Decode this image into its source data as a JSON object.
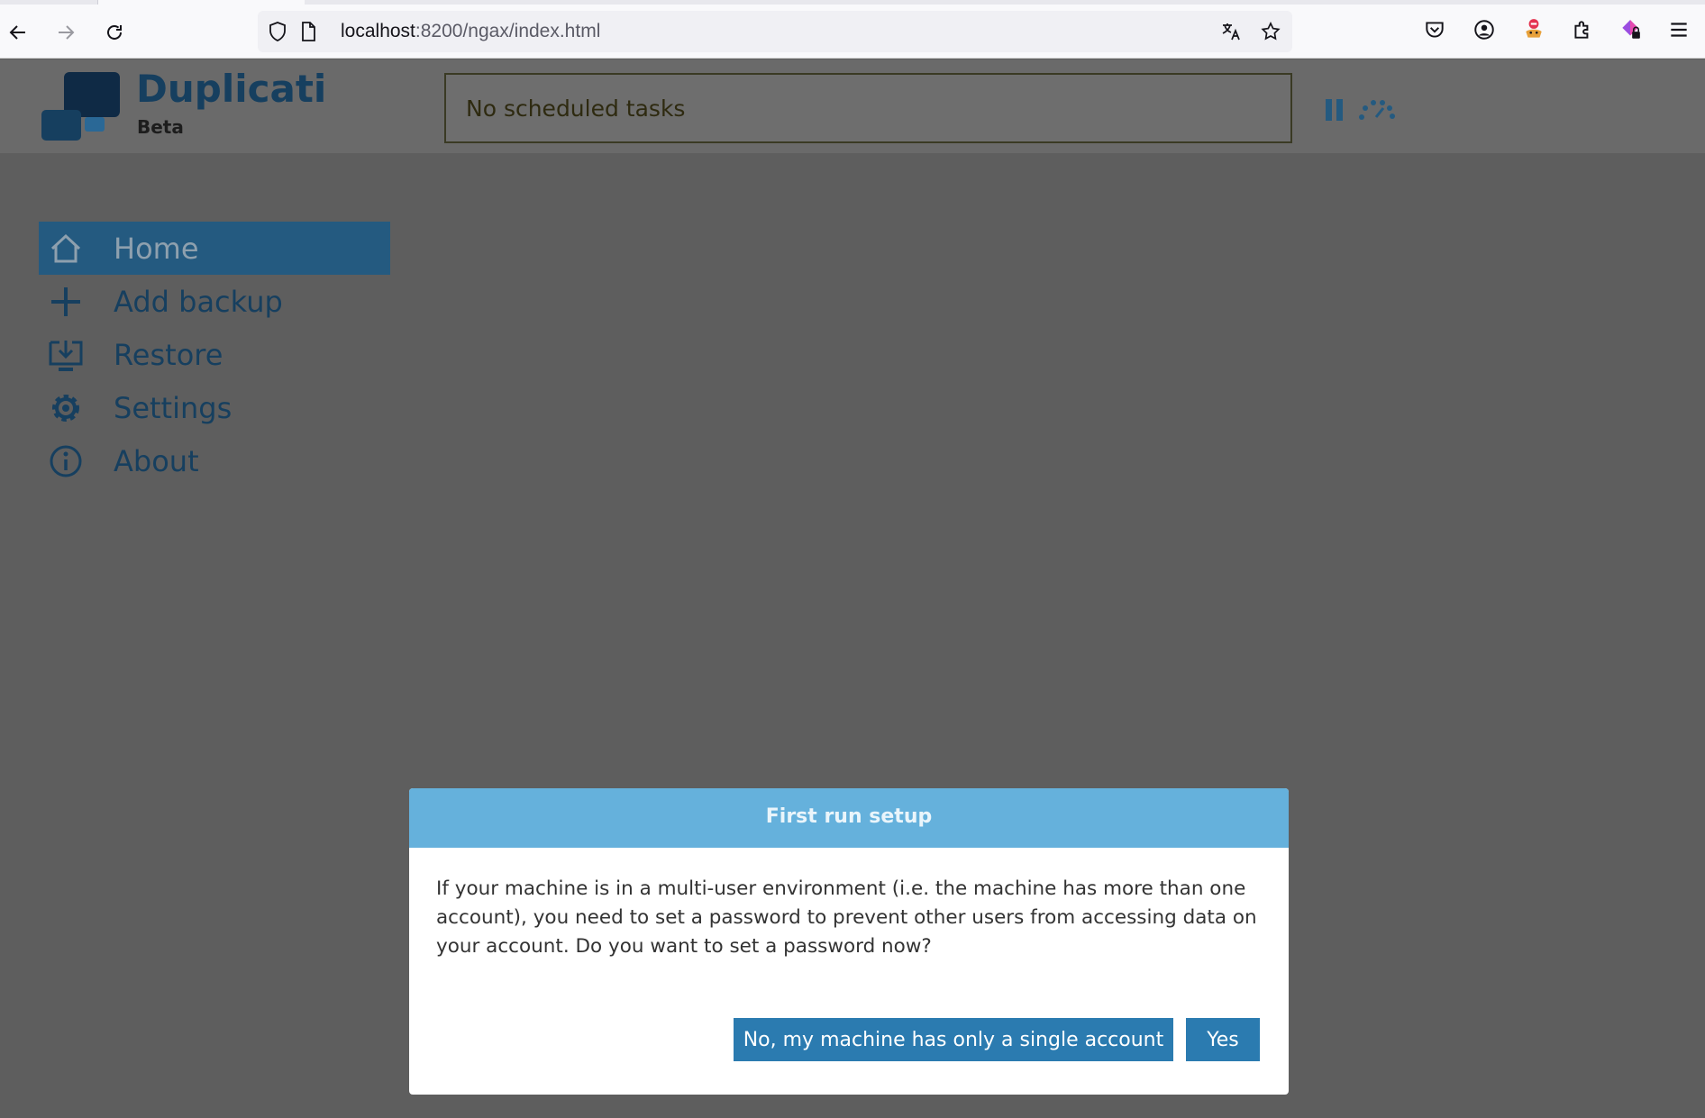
{
  "browser": {
    "url_host": "localhost",
    "url_rest": ":8200/ngax/index.html"
  },
  "app": {
    "brand_name": "Duplicati",
    "brand_sub": "Beta",
    "status_text": "No scheduled tasks"
  },
  "sidebar": {
    "items": [
      {
        "label": "Home",
        "icon": "home-icon",
        "active": true
      },
      {
        "label": "Add backup",
        "icon": "plus-icon",
        "active": false
      },
      {
        "label": "Restore",
        "icon": "restore-icon",
        "active": false
      },
      {
        "label": "Settings",
        "icon": "gear-icon",
        "active": false
      },
      {
        "label": "About",
        "icon": "info-icon",
        "active": false
      }
    ]
  },
  "modal": {
    "title": "First run setup",
    "body": "If your machine is in a multi-user environment (i.e. the machine has more than one account), you need to set a password to prevent other users from accessing data on your account. Do you want to set a password now?",
    "no_label": "No, my machine has only a single account",
    "yes_label": "Yes"
  },
  "colors": {
    "brand": "#163f5f",
    "active_menu": "#245a80",
    "modal_header": "#65b1dc",
    "button": "#2b7bb0"
  }
}
